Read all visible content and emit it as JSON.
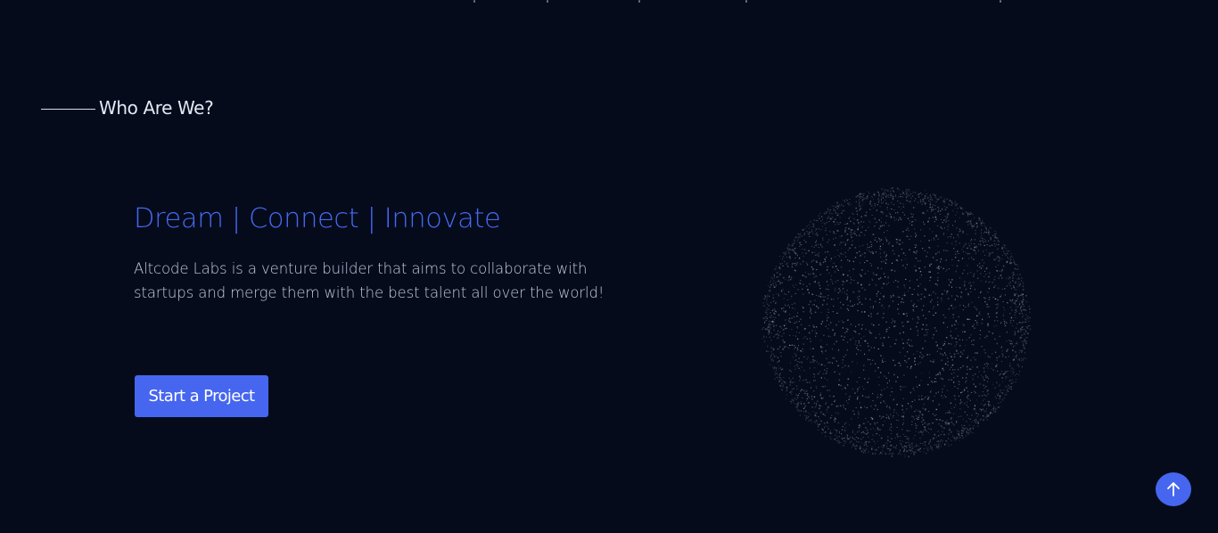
{
  "section": {
    "heading": "Who Are We?"
  },
  "hero": {
    "tagline": "Dream | Connect | Innovate",
    "description": "Altcode Labs is a venture builder that aims to collaborate with startups and merge them with the best talent all over the world!",
    "cta_label": "Start a Project"
  },
  "icons": {
    "scroll_top": "arrow-up-icon",
    "sphere": "particle-sphere"
  },
  "colors": {
    "background": "#050b1b",
    "accent": "#4666ef",
    "tagline": "#4668f0",
    "text": "#c5cbe0",
    "heading": "#e3e8f4"
  }
}
